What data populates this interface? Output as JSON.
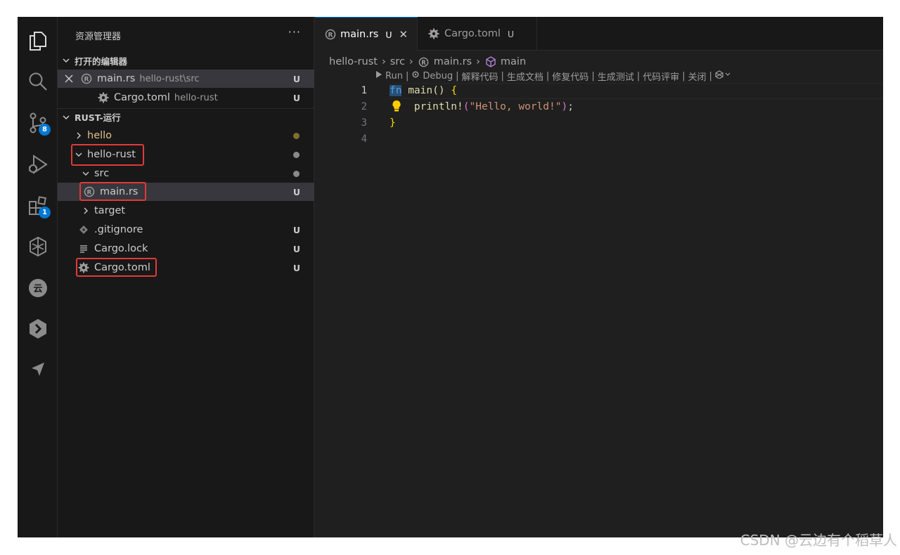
{
  "sidebar": {
    "title": "资源管理器",
    "more": "···",
    "open_editors": {
      "header": "打开的编辑器",
      "items": [
        {
          "name": "main.rs",
          "path": "hello-rust\\src",
          "status": "U"
        },
        {
          "name": "Cargo.toml",
          "path": "hello-rust",
          "status": "U"
        }
      ]
    },
    "workspace": {
      "header": "RUST-运行",
      "items": [
        {
          "name": "hello",
          "status": ""
        },
        {
          "name": "hello-rust",
          "status": ""
        },
        {
          "name": "src",
          "status": ""
        },
        {
          "name": "main.rs",
          "status": "U"
        },
        {
          "name": "target",
          "status": ""
        },
        {
          "name": ".gitignore",
          "status": "U"
        },
        {
          "name": "Cargo.lock",
          "status": "U"
        },
        {
          "name": "Cargo.toml",
          "status": "U"
        }
      ]
    }
  },
  "activity": {
    "scm_badge": "8",
    "extensions_badge": "1"
  },
  "editor": {
    "tabs": [
      {
        "name": "main.rs",
        "status": "U",
        "close": "✕"
      },
      {
        "name": "Cargo.toml",
        "status": "U"
      }
    ],
    "breadcrumb": [
      "hello-rust",
      "src",
      "main.rs",
      "main"
    ],
    "codelens": [
      "Run",
      "Debug",
      "解释代码",
      "生成文档",
      "修复代码",
      "生成测试",
      "代码评审",
      "关闭"
    ],
    "line_numbers": [
      "1",
      "2",
      "3",
      "4"
    ],
    "code": {
      "l1_kw": "fn",
      "l1_name": " main",
      "l1_rest": "() ",
      "l1_brace": "{",
      "l2_indent": "    ",
      "l2_macro": "println!",
      "l2_open": "(",
      "l2_str": "\"Hello, world!\"",
      "l2_close": ")",
      "l2_semi": ";",
      "l3_brace": "}"
    }
  },
  "watermark": "CSDN @云边有个稻草人",
  "colors": {
    "accent": "#0078d4",
    "highlight_box": "#e03a3a",
    "folder_yellow": "#e2c08d"
  }
}
